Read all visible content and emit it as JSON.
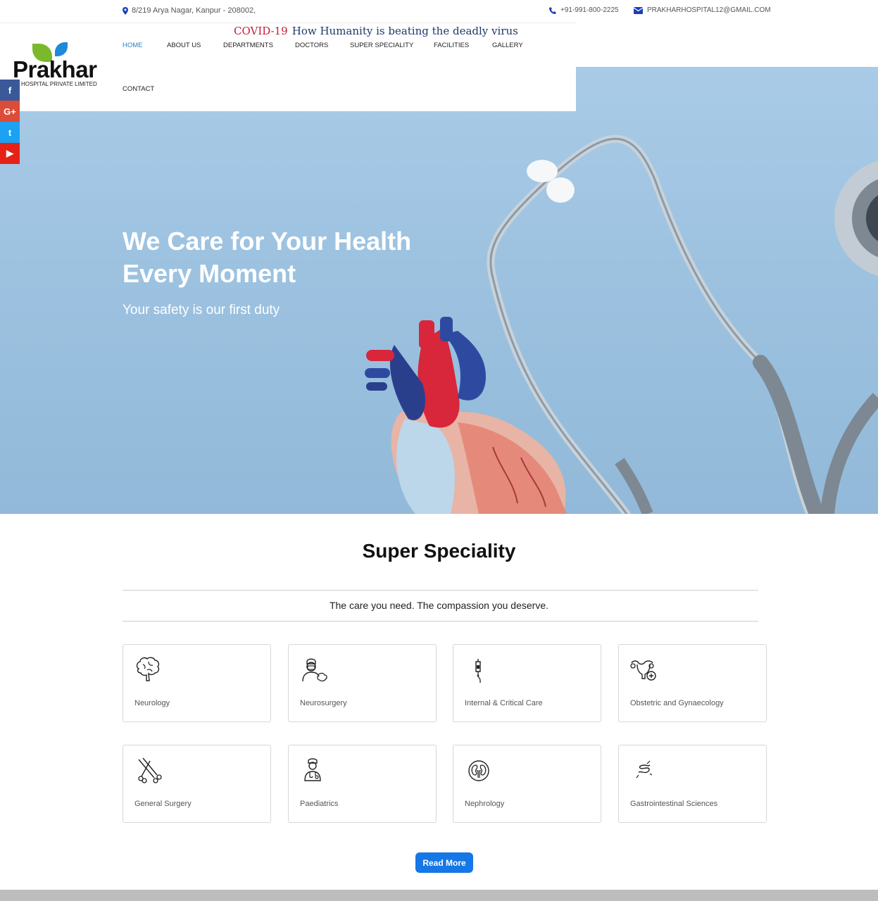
{
  "topbar": {
    "address": "8/219 Arya Nagar, Kanpur - 208002,",
    "phone": "+91-991-800-2225",
    "email": "PRAKHARHOSPITAL12@GMAIL.COM"
  },
  "ticker": {
    "tag": "COVID-19",
    "text": "How Humanity is beating the deadly virus"
  },
  "logo": {
    "name": "Prakhar",
    "subtitle": "HOSPITAL PRIVATE LIMITED"
  },
  "nav": {
    "items": [
      "HOME",
      "ABOUT US",
      "DEPARTMENTS",
      "DOCTORS",
      "SUPER SPECIALITY",
      "FACILITIES",
      "GALLERY",
      "CONTACT"
    ],
    "active": "HOME"
  },
  "social": {
    "facebook": "f",
    "google": "G+",
    "twitter": "t",
    "youtube": "▶"
  },
  "hero": {
    "heading": "We Care for Your Health Every Moment",
    "tagline": "Your safety is our first duty"
  },
  "speciality": {
    "title": "Super Speciality",
    "subtitle": "The care you need. The compassion you deserve.",
    "cards": [
      {
        "label": "Neurology",
        "icon": "brain-icon"
      },
      {
        "label": "Neurosurgery",
        "icon": "surgeon-icon"
      },
      {
        "label": "Internal & Critical Care",
        "icon": "iv-drip-icon"
      },
      {
        "label": "Obstetric and Gynaecology",
        "icon": "uterus-icon"
      },
      {
        "label": "General Surgery",
        "icon": "surgical-tools-icon"
      },
      {
        "label": "Paediatrics",
        "icon": "doctor-icon"
      },
      {
        "label": "Nephrology",
        "icon": "kidney-icon"
      },
      {
        "label": "Gastrointestinal Sciences",
        "icon": "intestine-icon"
      }
    ],
    "read_more": "Read More"
  },
  "colors": {
    "accent": "#1677e6",
    "nav_active": "#2e7fc3",
    "hero_bg": "#9ec3e1"
  }
}
